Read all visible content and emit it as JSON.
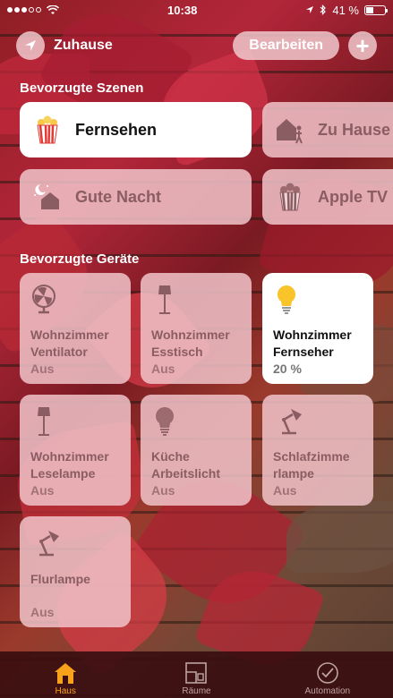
{
  "status_bar": {
    "time": "10:38",
    "battery": "41 %",
    "battery_level": 0.41
  },
  "header": {
    "home_label": "Zuhause",
    "edit_label": "Bearbeiten",
    "add_label": "+"
  },
  "sections": {
    "scenes_title": "Bevorzugte Szenen",
    "devices_title": "Bevorzugte Geräte"
  },
  "scenes": [
    {
      "label": "Fernsehen",
      "icon": "popcorn-icon",
      "active": true
    },
    {
      "label": "Zu Hause",
      "icon": "house-person-icon",
      "active": false
    },
    {
      "label": "Gute Nacht",
      "icon": "moon-house-icon",
      "active": false
    },
    {
      "label": "Apple TV",
      "icon": "popcorn-icon",
      "active": false
    }
  ],
  "devices": [
    {
      "name": "Wohnzimmer\nVentilator",
      "status": "Aus",
      "icon": "fan-icon",
      "on": false
    },
    {
      "name": "Wohnzimmer\nEsstisch",
      "status": "Aus",
      "icon": "floor-lamp-icon",
      "on": false
    },
    {
      "name": "Wohnzimmer\nFernseher",
      "status": "20 %",
      "icon": "lightbulb-icon",
      "on": true
    },
    {
      "name": "Wohnzimmer\nLeselampe",
      "status": "Aus",
      "icon": "floor-lamp-icon",
      "on": false
    },
    {
      "name": "Küche\nArbeitslicht",
      "status": "Aus",
      "icon": "lightbulb-icon",
      "on": false
    },
    {
      "name": "Schlafzimme\nrlampe",
      "status": "Aus",
      "icon": "desk-lamp-icon",
      "on": false
    },
    {
      "name": "Flurlampe",
      "status": "Aus",
      "icon": "desk-lamp-icon",
      "on": false
    }
  ],
  "tabs": [
    {
      "label": "Haus",
      "icon": "house-icon",
      "active": true
    },
    {
      "label": "Räume",
      "icon": "rooms-icon",
      "active": false
    },
    {
      "label": "Automation",
      "icon": "clock-icon",
      "active": false
    }
  ],
  "colors": {
    "accent": "#f7a21a",
    "bulb_on": "#f8c42a",
    "tile": "#f0c3c8",
    "tile_text": "#8a5d62"
  }
}
